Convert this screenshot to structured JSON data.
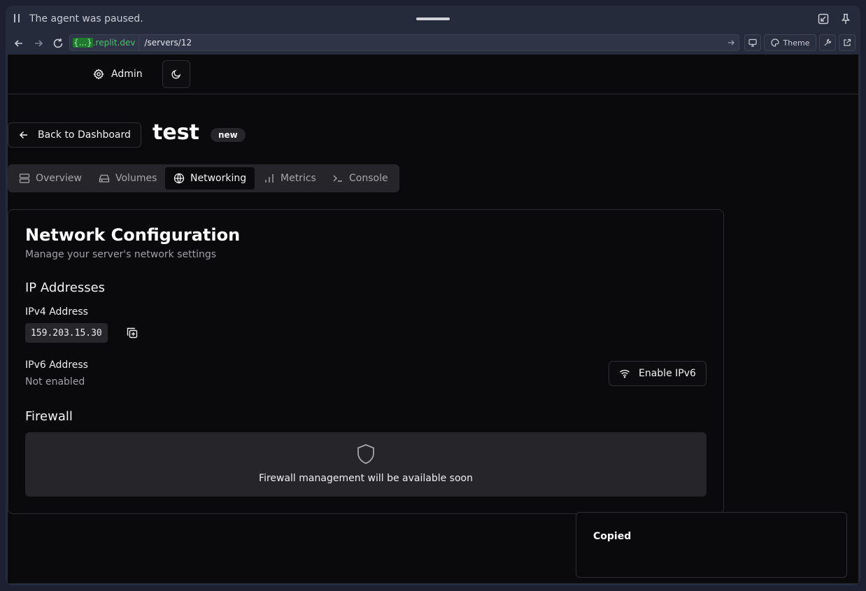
{
  "agent_bar": {
    "status_text": "The agent was paused."
  },
  "browser": {
    "url_host_highlight": "{...}",
    "url_host_rest": ".replit.dev",
    "url_path": "/servers/12",
    "theme_label": "Theme"
  },
  "header": {
    "admin_label": "Admin"
  },
  "page": {
    "back_label": "Back to Dashboard",
    "title": "test",
    "badge": "new"
  },
  "tabs": [
    {
      "label": "Overview",
      "active": false
    },
    {
      "label": "Volumes",
      "active": false
    },
    {
      "label": "Networking",
      "active": true
    },
    {
      "label": "Metrics",
      "active": false
    },
    {
      "label": "Console",
      "active": false
    }
  ],
  "card": {
    "title": "Network Configuration",
    "subtitle": "Manage your server's network settings",
    "ip_section": "IP Addresses",
    "ipv4_label": "IPv4 Address",
    "ipv4_value": "159.203.15.30",
    "ipv6_label": "IPv6 Address",
    "ipv6_value": "Not enabled",
    "enable_ipv6_label": "Enable IPv6",
    "firewall_section": "Firewall",
    "firewall_message": "Firewall management will be available soon"
  },
  "toast": {
    "title": "Copied"
  },
  "colors": {
    "background": "#0a0a0c",
    "muted_surface": "#26262a",
    "url_host_accent": "#4ec26a"
  }
}
